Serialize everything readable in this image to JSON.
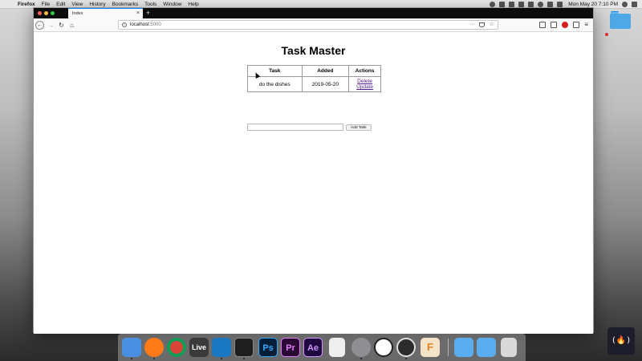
{
  "menubar": {
    "app_name": "Firefox",
    "items": [
      "File",
      "Edit",
      "View",
      "History",
      "Bookmarks",
      "Tools",
      "Window",
      "Help"
    ],
    "clock": "Mon May 20  7:10 PM"
  },
  "browser": {
    "tab_title": "Index",
    "url_host": "localhost",
    "url_port": ":5000"
  },
  "page": {
    "title": "Task Master",
    "table": {
      "headers": [
        "Task",
        "Added",
        "Actions"
      ],
      "rows": [
        {
          "task": "do the dishes",
          "added": "2019-05-20",
          "actions": [
            "Delete",
            "Update"
          ]
        }
      ]
    },
    "add_button_label": "Add Task"
  },
  "dock": {
    "live_label": "Live",
    "apps": [
      "finder-icon",
      "firefox-icon",
      "chrome-icon",
      "ableton-live-icon",
      "vscode-icon",
      "terminal-icon",
      "photoshop-icon",
      "premiere-icon",
      "after-effects-icon",
      "notes-icon",
      "system-preferences-icon",
      "app-icon",
      "obs-icon",
      "fusion-icon",
      "downloads-folder-icon",
      "applications-folder-icon",
      "trash-icon"
    ],
    "ps_label": "Ps",
    "pr_label": "Pr",
    "ae_label": "Ae",
    "f_label": "F"
  },
  "badge_text": "(🔥)"
}
